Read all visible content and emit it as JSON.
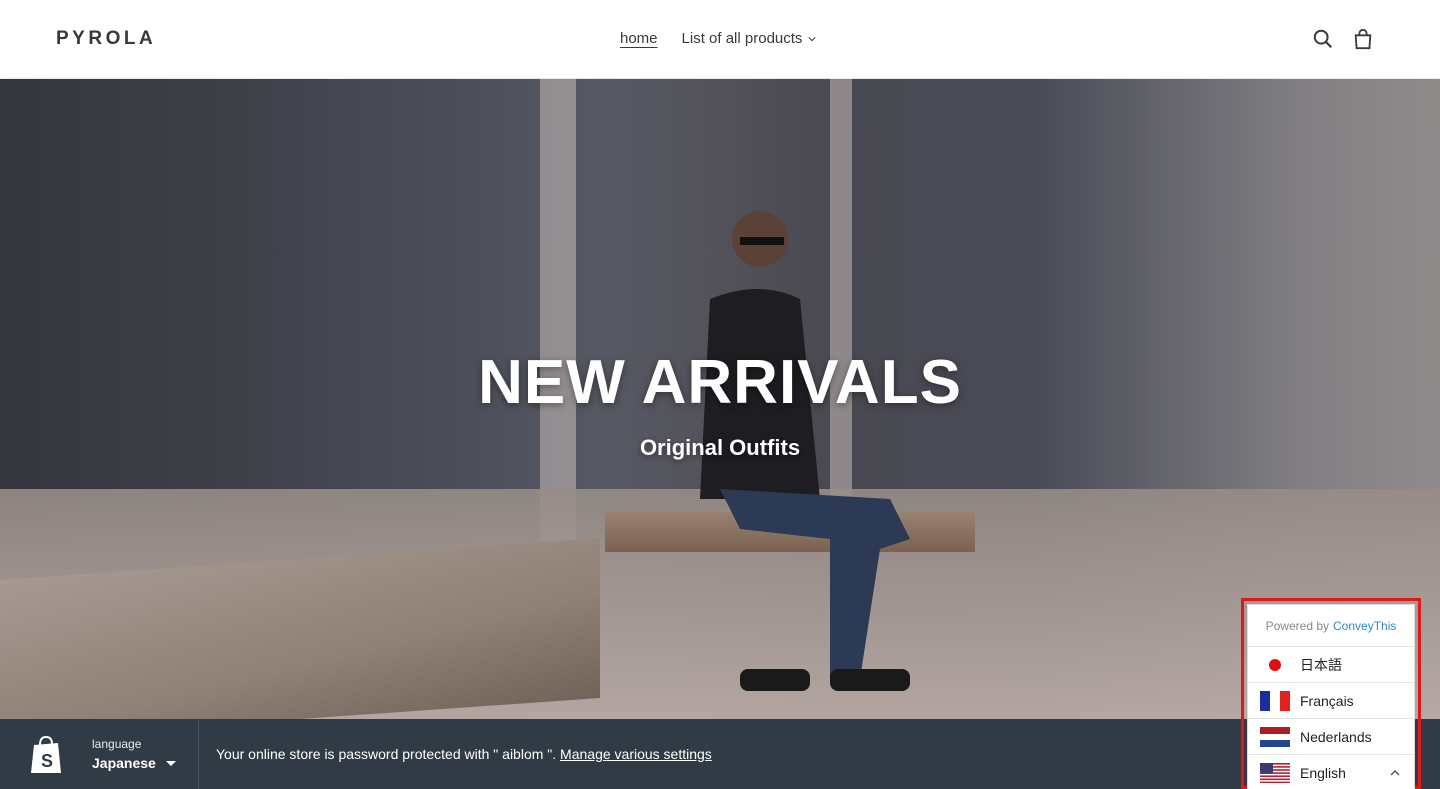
{
  "header": {
    "logo": "PYROLA",
    "nav": [
      {
        "label": "home"
      },
      {
        "label": "List of all products"
      }
    ]
  },
  "hero": {
    "title": "NEW ARRIVALS",
    "subtitle": "Original Outfits"
  },
  "bottombar": {
    "language_label": "language",
    "language_value": "Japanese",
    "message": "Your online store is password protected with \" aiblom \".",
    "link": "Manage various settings"
  },
  "switcher": {
    "powered_prefix": "Powered by",
    "powered_brand": "ConveyThis",
    "languages": [
      {
        "label": "日本語",
        "flag": "jp-flag-icon"
      },
      {
        "label": "Français",
        "flag": "fr-flag-icon"
      },
      {
        "label": "Nederlands",
        "flag": "nl-flag-icon"
      },
      {
        "label": "English",
        "flag": "us-flag-icon"
      }
    ]
  },
  "colors": {
    "bottombar": "#303b45",
    "highlight": "#e01818",
    "brand_link": "#2a8ad4"
  }
}
